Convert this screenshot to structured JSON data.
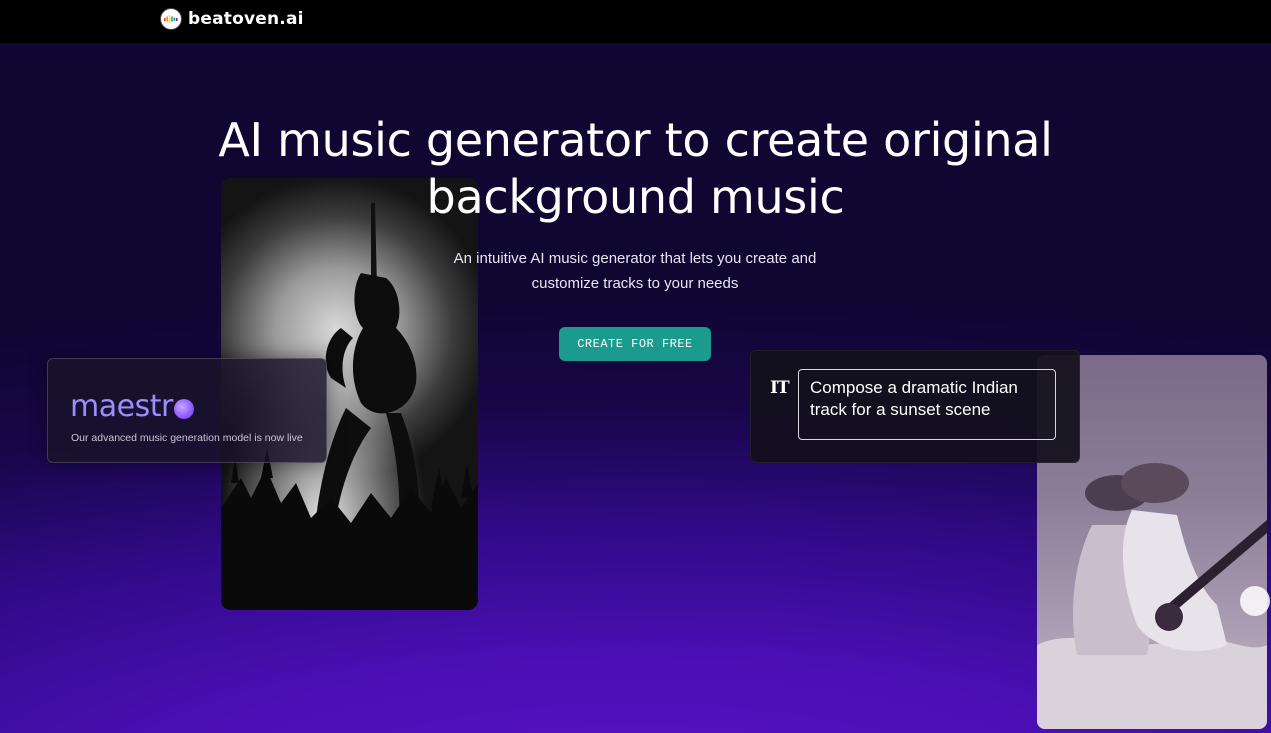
{
  "header": {
    "brand_name": "beatoven.ai",
    "brand_icon": "beatoven-logo-icon"
  },
  "hero": {
    "title_line1": "AI music generator to create original",
    "title_line2": "background music",
    "subtitle_line1": "An intuitive AI music generator that lets you create and",
    "subtitle_line2": "customize tracks to your needs",
    "cta_label": "CREATE FOR FREE"
  },
  "maestro_card": {
    "logo_text": "maestr",
    "description": "Our advanced music generation model is now live"
  },
  "prompt_card": {
    "icon_text": "IT",
    "prompt_text": "Compose a dramatic Indian track for a sunset scene"
  },
  "colors": {
    "cta_bg": "#1b9a8e",
    "maestro_accent": "#9b8cff",
    "bg_dark": "#0f0632",
    "bg_purple": "#5a11c9"
  }
}
